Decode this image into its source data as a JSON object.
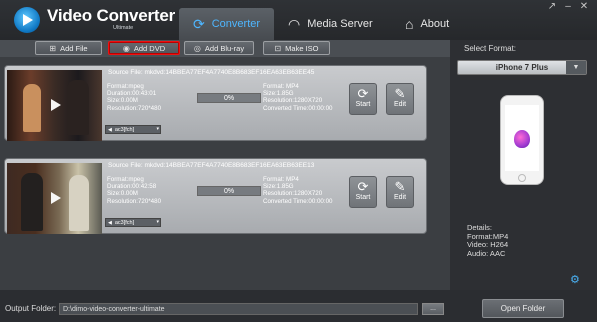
{
  "app": {
    "title": "Video Converter",
    "subtitle": "Ultimate",
    "tabs": [
      {
        "label": "Converter",
        "icon": "refresh-icon",
        "active": true
      },
      {
        "label": "Media Server",
        "icon": "wifi-icon",
        "active": false
      },
      {
        "label": "About",
        "icon": "home-icon",
        "active": false
      }
    ],
    "window_buttons": [
      "↗",
      "–",
      "✕"
    ]
  },
  "toolbar": {
    "add_file": "Add File",
    "add_dvd": "Add DVD",
    "add_bluray": "Add Blu-ray",
    "make_iso": "Make ISO"
  },
  "items": [
    {
      "source": "Source File: mkdvd:14BBEA77EF4A7740E8B683EF16EA63EB63EE45",
      "src_format": "Format:mpeg",
      "src_duration": "Duration:00:43:01",
      "src_size": "Size:0.00M",
      "src_resolution": "Resolution:720*480",
      "progress": "0%",
      "dst_format": "Format: MP4",
      "dst_size": "Size:1.85G",
      "dst_resolution": "Resolution:1280X720",
      "dst_time": "Converted Time:00:00:00",
      "start": "Start",
      "edit": "Edit",
      "audio": "ac3[fch]"
    },
    {
      "source": "Source File: mkdvd:14BBEA77EF4A7740E8B683EF16EA63EB63EE13",
      "src_format": "Format:mpeg",
      "src_duration": "Duration:00:42:58",
      "src_size": "Size:0.00M",
      "src_resolution": "Resolution:720*480",
      "progress": "0%",
      "dst_format": "Format: MP4",
      "dst_size": "Size:1.85G",
      "dst_resolution": "Resolution:1280X720",
      "dst_time": "Converted Time:00:00:00",
      "start": "Start",
      "edit": "Edit",
      "audio": "ac3[fch]"
    }
  ],
  "side": {
    "label": "Select Format:",
    "format": "iPhone 7 Plus",
    "details_title": "Details:",
    "details_format": "Format:MP4",
    "details_video": "Video: H264",
    "details_audio": "Audio: AAC"
  },
  "footer": {
    "label": "Output Folder:",
    "path": "D:\\dimo-video-converter-ultimate",
    "browse": "...",
    "open": "Open Folder"
  },
  "colors": {
    "accent": "#4eb6ff",
    "selected_border": "#e11111"
  }
}
